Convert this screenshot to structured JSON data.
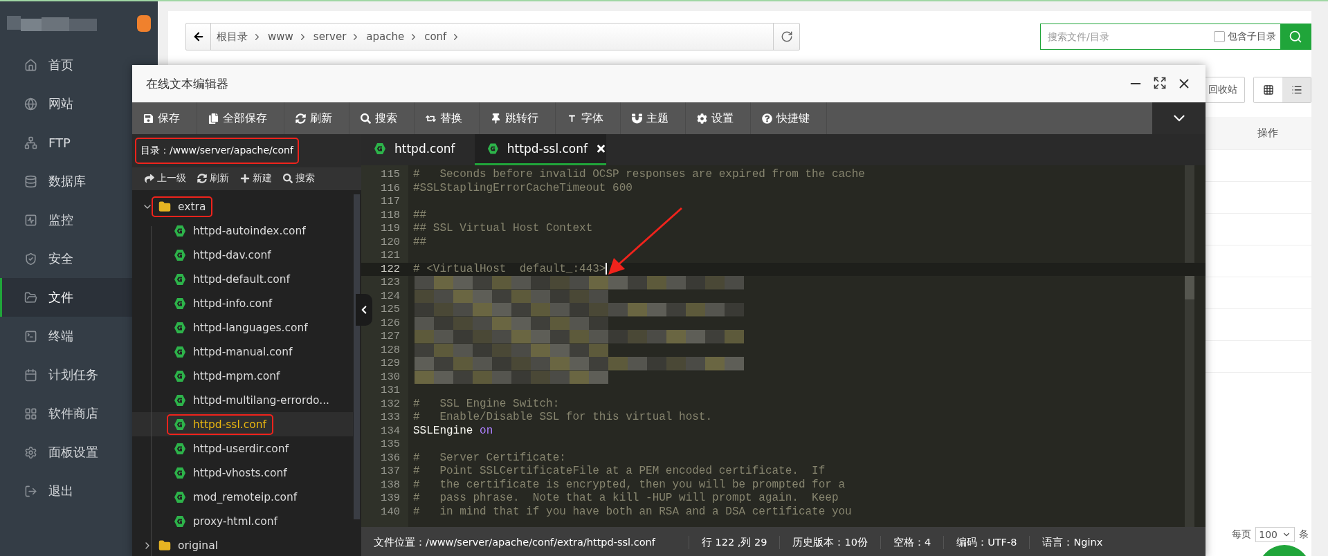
{
  "sidebar": {
    "items": [
      {
        "label": "首页",
        "selected": false
      },
      {
        "label": "网站",
        "selected": false
      },
      {
        "label": "FTP",
        "selected": false
      },
      {
        "label": "数据库",
        "selected": false
      },
      {
        "label": "监控",
        "selected": false
      },
      {
        "label": "安全",
        "selected": false
      },
      {
        "label": "文件",
        "selected": true
      },
      {
        "label": "终端",
        "selected": false
      },
      {
        "label": "计划任务",
        "selected": false
      },
      {
        "label": "软件商店",
        "selected": false
      },
      {
        "label": "面板设置",
        "selected": false
      },
      {
        "label": "退出",
        "selected": false
      }
    ]
  },
  "breadcrumb": {
    "items": [
      "根目录",
      "www",
      "server",
      "apache",
      "conf"
    ]
  },
  "search": {
    "placeholder": "搜索文件/目录",
    "subdirs_label": "包含子目录",
    "subdirs_checked": false
  },
  "recycle_label": "回收站",
  "views": [
    {
      "selected": false
    },
    {
      "selected": true
    }
  ],
  "table": {
    "columns": [
      "操作"
    ]
  },
  "pagination": {
    "label": "每页",
    "page_size": "100",
    "unit": "条"
  },
  "editor": {
    "title": "在线文本编辑器",
    "toolbar": [
      "保存",
      "全部保存",
      "刷新",
      "搜索",
      "替换",
      "跳转行",
      "字体",
      "主题",
      "设置",
      "快捷键"
    ],
    "directory": {
      "label": "目录：/www/server/apache/conf",
      "marked": true
    },
    "tree_actions": [
      "上一级",
      "刷新",
      "新建",
      "搜索"
    ],
    "tree": [
      {
        "name": "extra",
        "kind": "folder",
        "expanded": true,
        "marked": true,
        "selected": false,
        "children": [
          {
            "name": "httpd-autoindex.conf",
            "kind": "file",
            "marked": false,
            "selected": false
          },
          {
            "name": "httpd-dav.conf",
            "kind": "file",
            "marked": false,
            "selected": false
          },
          {
            "name": "httpd-default.conf",
            "kind": "file",
            "marked": false,
            "selected": false
          },
          {
            "name": "httpd-info.conf",
            "kind": "file",
            "marked": false,
            "selected": false
          },
          {
            "name": "httpd-languages.conf",
            "kind": "file",
            "marked": false,
            "selected": false
          },
          {
            "name": "httpd-manual.conf",
            "kind": "file",
            "marked": false,
            "selected": false
          },
          {
            "name": "httpd-mpm.conf",
            "kind": "file",
            "marked": false,
            "selected": false
          },
          {
            "name": "httpd-multilang-errordo...",
            "kind": "file",
            "marked": false,
            "selected": false
          },
          {
            "name": "httpd-ssl.conf",
            "kind": "file",
            "marked": true,
            "selected": true
          },
          {
            "name": "httpd-userdir.conf",
            "kind": "file",
            "marked": false,
            "selected": false
          },
          {
            "name": "httpd-vhosts.conf",
            "kind": "file",
            "marked": false,
            "selected": false
          },
          {
            "name": "mod_remoteip.conf",
            "kind": "file",
            "marked": false,
            "selected": false
          },
          {
            "name": "proxy-html.conf",
            "kind": "file",
            "marked": false,
            "selected": false
          }
        ]
      },
      {
        "name": "original",
        "kind": "folder",
        "expanded": false,
        "marked": false,
        "selected": false
      }
    ],
    "tabs": [
      {
        "label": "httpd.conf",
        "selected": false
      },
      {
        "label": "httpd-ssl.conf",
        "selected": true
      }
    ],
    "annotation_arrow": true,
    "lines": [
      {
        "number": "115",
        "kind": "comment",
        "text": "#   Seconds before invalid OCSP responses are expired from the cache",
        "active": false
      },
      {
        "number": "116",
        "kind": "comment",
        "text": "#SSLStaplingErrorCacheTimeout 600",
        "active": false
      },
      {
        "number": "117",
        "kind": "blank",
        "active": false
      },
      {
        "number": "118",
        "kind": "comment",
        "text": "##",
        "active": false
      },
      {
        "number": "119",
        "kind": "comment",
        "text": "## SSL Virtual Host Context",
        "active": false
      },
      {
        "number": "120",
        "kind": "comment",
        "text": "##",
        "active": false
      },
      {
        "number": "121",
        "kind": "blank",
        "active": false
      },
      {
        "number": "122",
        "kind": "comment",
        "text": "# <VirtualHost  default_:443>",
        "active": true
      },
      {
        "number": "123",
        "kind": "redacted",
        "active": false
      },
      {
        "number": "124",
        "kind": "redacted",
        "active": false
      },
      {
        "number": "125",
        "kind": "redacted",
        "active": false
      },
      {
        "number": "126",
        "kind": "redacted",
        "active": false
      },
      {
        "number": "127",
        "kind": "redacted",
        "active": false
      },
      {
        "number": "128",
        "kind": "redacted",
        "active": false
      },
      {
        "number": "129",
        "kind": "redacted",
        "active": false
      },
      {
        "number": "130",
        "kind": "redacted",
        "active": false
      },
      {
        "number": "131",
        "kind": "blank",
        "active": false
      },
      {
        "number": "132",
        "kind": "comment",
        "text": "#   SSL Engine Switch:",
        "active": false
      },
      {
        "number": "133",
        "kind": "comment",
        "text": "#   Enable/Disable SSL for this virtual host.",
        "active": false
      },
      {
        "number": "134",
        "kind": "directive",
        "keyword": "SSLEngine",
        "value": "on",
        "active": false
      },
      {
        "number": "135",
        "kind": "blank",
        "active": false
      },
      {
        "number": "136",
        "kind": "comment",
        "text": "#   Server Certificate:",
        "active": false
      },
      {
        "number": "137",
        "kind": "comment",
        "text": "#   Point SSLCertificateFile at a PEM encoded certificate.  If",
        "active": false
      },
      {
        "number": "138",
        "kind": "comment",
        "text": "#   the certificate is encrypted, then you will be prompted for a",
        "active": false
      },
      {
        "number": "139",
        "kind": "comment",
        "text": "#   pass phrase.  Note that a kill -HUP will prompt again.  Keep",
        "active": false
      },
      {
        "number": "140",
        "kind": "comment",
        "text": "#   in mind that if you have both an RSA and a DSA certificate you",
        "active": false
      }
    ],
    "status": [
      "文件位置：/www/server/apache/conf/extra/httpd-ssl.conf",
      "行 122 ,列 29",
      "历史版本：10份",
      "空格：4",
      "编码：UTF-8",
      "语言：Nginx"
    ]
  }
}
